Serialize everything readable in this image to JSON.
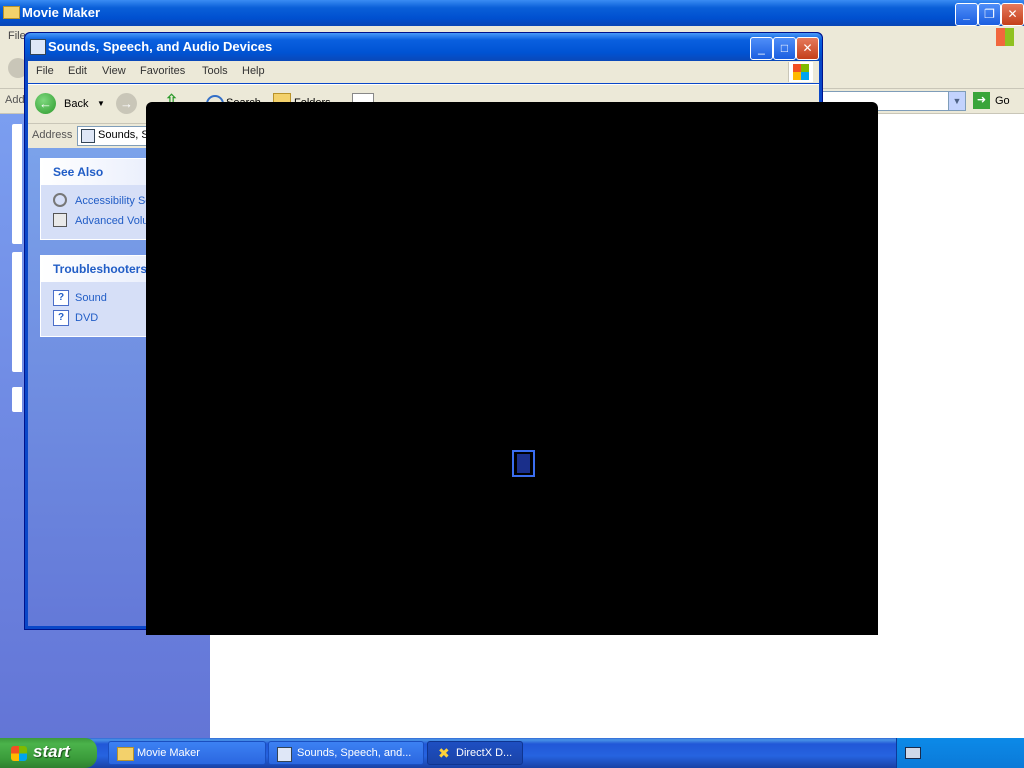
{
  "background_window": {
    "title": "Movie Maker",
    "menu_first": "File",
    "address_first": "Address",
    "go_label": "Go"
  },
  "sounds_window": {
    "title": "Sounds, Speech, and Audio Devices",
    "menu": [
      "File",
      "Edit",
      "View",
      "Favorites",
      "Tools",
      "Help"
    ],
    "toolbar": {
      "back": "Back",
      "search": "Search",
      "folders": "Folders"
    },
    "address_label": "Address",
    "address_value": "Sounds, S",
    "see_also": {
      "title": "See Also",
      "items": [
        "Accessibility So",
        "Advanced Volu"
      ]
    },
    "troubleshooters": {
      "title": "Troubleshooters",
      "items": [
        "Sound",
        "DVD"
      ]
    }
  },
  "taskbar": {
    "start_label": "start",
    "tasks": [
      {
        "label": "Movie Maker",
        "icon": "folder-icon"
      },
      {
        "label": "Sounds, Speech, and...",
        "icon": "control-panel-icon"
      },
      {
        "label": "DirectX D...",
        "icon": "directx-icon"
      }
    ]
  },
  "colors": {
    "xp_blue": "#0a5fd8",
    "task_pane": "#7ba2ea",
    "link": "#215dc6",
    "start_green": "#3c9a3c"
  }
}
